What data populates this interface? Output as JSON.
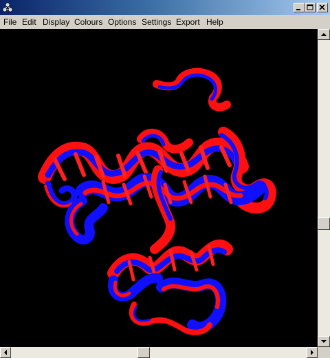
{
  "menu": {
    "file": "File",
    "edit": "Edit",
    "display": "Display",
    "colours": "Colours",
    "options": "Options",
    "settings": "Settings",
    "export": "Export",
    "help": "Help"
  },
  "colors": {
    "viewport_background": "#000000",
    "structure_a": "#ff0000",
    "structure_b": "#0000ff",
    "titlebar_start": "#0a246a",
    "titlebar_end": "#a6caf0"
  },
  "icons": {
    "app": "molecule-icon",
    "minimize": "minimize-icon",
    "maximize": "maximize-icon",
    "close": "close-icon"
  }
}
